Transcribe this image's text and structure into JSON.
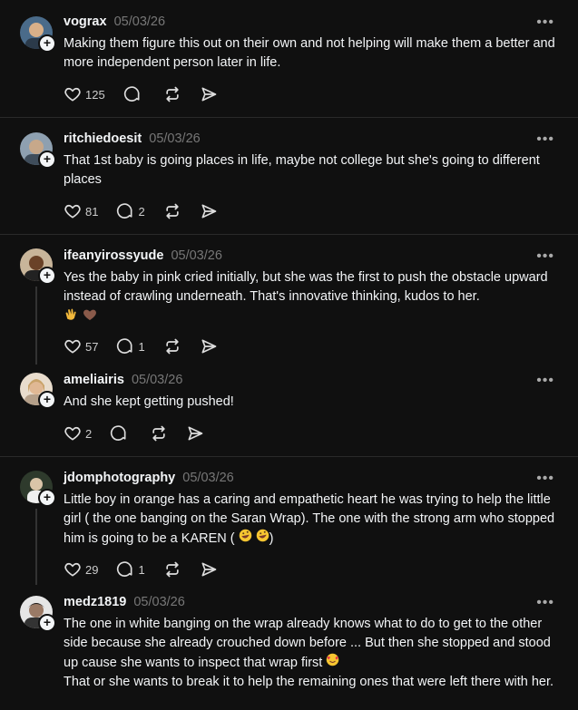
{
  "posts": [
    {
      "username": "vograx",
      "date": "05/03/26",
      "text": "Making them figure this out on their own and not helping will make them a better and more independent person later in life.",
      "likes": "125",
      "replies": "",
      "avatar_color": "#4a6b8a"
    },
    {
      "username": "ritchiedoesit",
      "date": "05/03/26",
      "text": "That 1st baby is going places in life, maybe not college but she's going to different places",
      "likes": "81",
      "replies": "2",
      "avatar_color": "#6b7f90"
    },
    {
      "username": "ifeanyirossyude",
      "date": "05/03/26",
      "text": "Yes the baby in pink cried initially, but she was the first to push the obstacle upward instead of crawling underneath. That's innovative thinking, kudos to her.",
      "likes": "57",
      "replies": "1",
      "avatar_color": "#7a5a3c"
    },
    {
      "username": "ameliairis",
      "date": "05/03/26",
      "text": "And she kept getting pushed!",
      "likes": "2",
      "replies": "",
      "avatar_color": "#c9a27c"
    },
    {
      "username": "jdomphotography",
      "date": "05/03/26",
      "text": "Little boy in orange has a caring and empathetic heart he was trying to help the little girl ( the one banging on the Saran Wrap). The one with the strong arm who stopped him is going to be a KAREN (",
      "text_end": ")",
      "likes": "29",
      "replies": "1",
      "avatar_color": "#3c4a3a"
    },
    {
      "username": "medz1819",
      "date": "05/03/26",
      "text": "The one in white banging on the wrap already knows what to do to get to the other side because she already crouched down before ... But then she stopped and stood up cause she wants to inspect that wrap first",
      "text2": "That or she wants to break it to help the remaining ones that were left there with her.",
      "avatar_color": "#d8d8d8"
    }
  ],
  "icons": {
    "like": "heart-icon",
    "reply": "comment-icon",
    "repost": "repost-icon",
    "share": "share-icon",
    "more": "more-icon",
    "follow": "plus-icon"
  },
  "more_glyph": "•••",
  "plus_glyph": "+"
}
